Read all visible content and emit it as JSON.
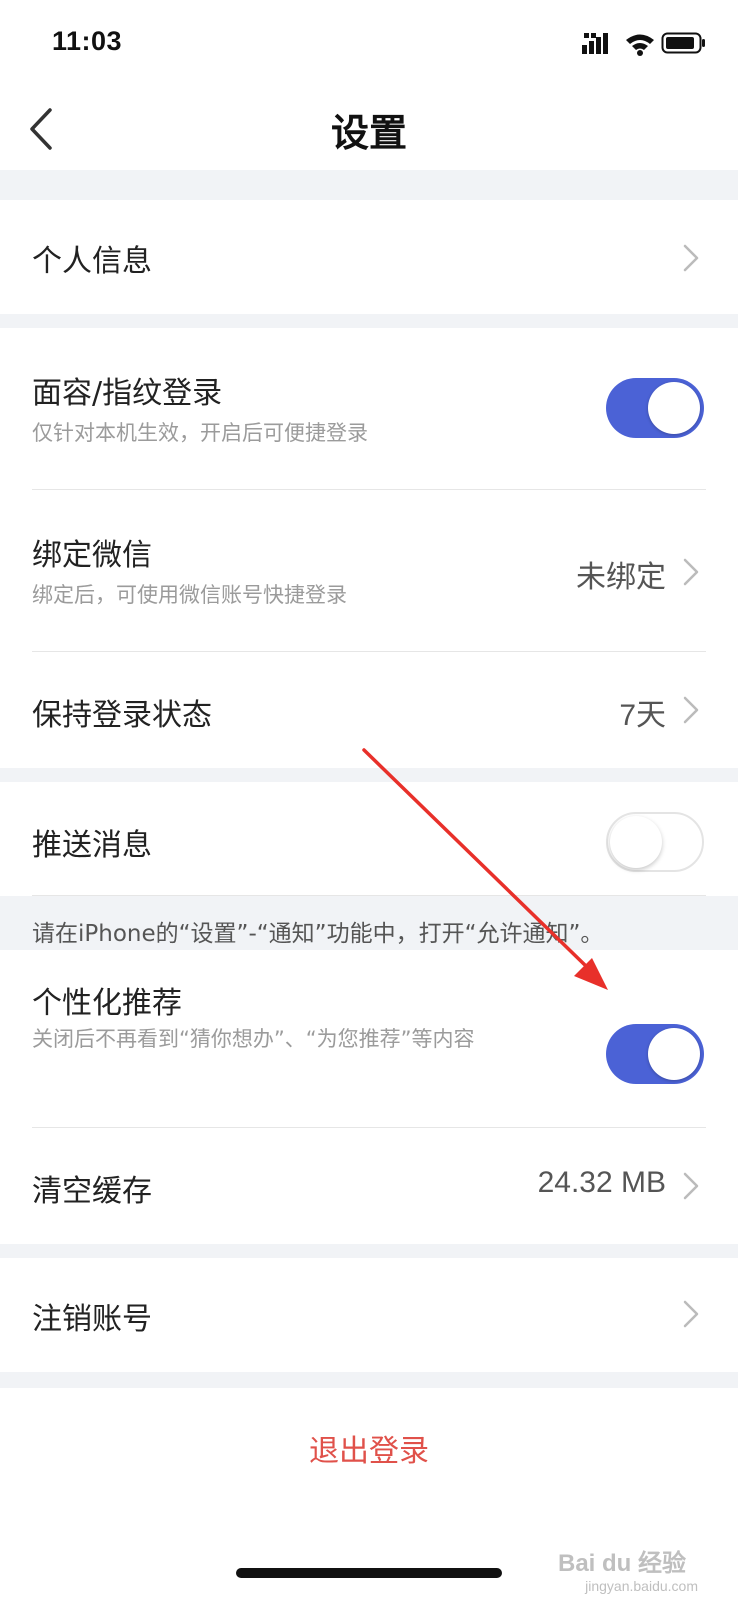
{
  "status_bar": {
    "time": "11:03",
    "icons": [
      "signal-icon",
      "wifi-icon",
      "battery-icon"
    ]
  },
  "nav": {
    "title": "设置",
    "back_icon": "chevron-left-icon"
  },
  "sections": {
    "personal_info": {
      "title": "个人信息"
    },
    "face_login": {
      "title": "面容/指纹登录",
      "subtitle": "仅针对本机生效，开启后可便捷登录",
      "enabled": true
    },
    "bind_wechat": {
      "title": "绑定微信",
      "subtitle": "绑定后，可使用微信账号快捷登录",
      "value": "未绑定"
    },
    "keep_login": {
      "title": "保持登录状态",
      "value": "7天"
    },
    "push": {
      "title": "推送消息",
      "enabled": false
    },
    "push_notice": "请在iPhone的“设置”-“通知”功能中，打开“允许通知”。",
    "personalized": {
      "title": "个性化推荐",
      "subtitle": "关闭后不再看到“猜你想办”、“为您推荐”等内容",
      "enabled": true
    },
    "clear_cache": {
      "title": "清空缓存",
      "value": "24.32 MB"
    },
    "deactivate": {
      "title": "注销账号"
    }
  },
  "logout_label": "退出登录",
  "watermark": {
    "main": "Bai du 经验",
    "sub": "jingyan.baidu.com"
  },
  "colors": {
    "accent": "#4b62d6",
    "danger": "#e0514a",
    "section_gap": "#f1f3f6",
    "annotation_arrow": "#e8302a"
  }
}
